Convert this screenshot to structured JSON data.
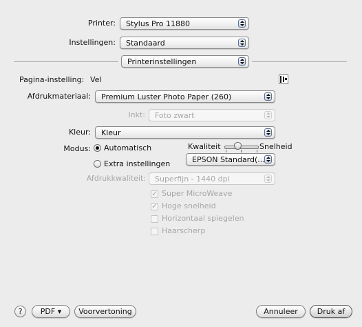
{
  "printer": {
    "label": "Printer:",
    "value": "Stylus Pro 11880"
  },
  "presets": {
    "label": "Instellingen:",
    "value": "Standaard"
  },
  "panel": {
    "value": "Printerinstellingen"
  },
  "page_setup": {
    "label": "Pagina-instelling:",
    "value": "Vel",
    "icon": "page-setup-icon"
  },
  "media": {
    "label": "Afdrukmateriaal:",
    "value": "Premium Luster Photo Paper (260)"
  },
  "ink": {
    "label": "Inkt:",
    "value": "Foto zwart"
  },
  "color": {
    "label": "Kleur:",
    "value": "Kleur"
  },
  "mode": {
    "label": "Modus:",
    "automatic_label": "Automatisch",
    "advanced_label": "Extra instellingen",
    "selected": "Automatisch"
  },
  "slider": {
    "left_label": "Kwaliteit",
    "right_label": "Snelheid",
    "ticks": 3,
    "position": 0
  },
  "epson_mode": {
    "value": "EPSON Standard(..."
  },
  "print_quality": {
    "label": "Afdrukkwaliteit:",
    "value": "Superfijn - 1440 dpi"
  },
  "checkboxes": [
    {
      "label": "Super MicroWeave",
      "checked": true
    },
    {
      "label": "Hoge snelheid",
      "checked": true
    },
    {
      "label": "Horizontaal spiegelen",
      "checked": false
    },
    {
      "label": "Haarscherp",
      "checked": false
    }
  ],
  "footer": {
    "help": "?",
    "pdf": "PDF ▾",
    "preview": "Voorvertoning",
    "cancel": "Annuleer",
    "print": "Druk af"
  }
}
